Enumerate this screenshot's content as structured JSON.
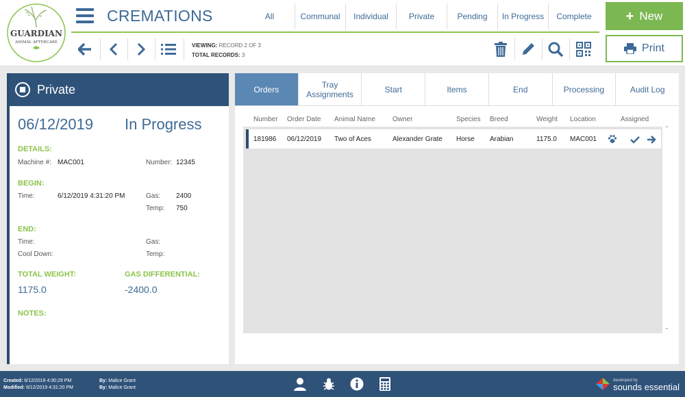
{
  "header": {
    "title": "CREMATIONS",
    "logo_main": "GUARDIAN",
    "logo_sub": "ANIMAL AFTERCARE",
    "filter_tabs": [
      "All",
      "Communal",
      "Individual",
      "Private",
      "Pending",
      "In Progress",
      "Complete"
    ],
    "new_label": "New",
    "print_label": "Print",
    "viewing_label": "VIEWING:",
    "viewing_value": "RECORD 2 OF 3",
    "total_label": "TOTAL RECORDS:",
    "total_value": "3"
  },
  "left": {
    "type": "Private",
    "date": "06/12/2019",
    "status": "In Progress",
    "details_label": "DETAILS:",
    "machine_label": "Machine #:",
    "machine_value": "MAC001",
    "number_label": "Number:",
    "number_value": "12345",
    "begin_label": "BEGIN:",
    "time_label": "Time:",
    "begin_time": "6/12/2019 4:31:20 PM",
    "gas_label": "Gas:",
    "begin_gas": "2400",
    "temp_label": "Temp:",
    "begin_temp": "750",
    "end_label": "END:",
    "cooldown_label": "Cool Down:",
    "total_weight_label": "TOTAL WEIGHT:",
    "total_weight_value": "1175.0",
    "gas_diff_label": "GAS DIFFERENTIAL:",
    "gas_diff_value": "-2400.0",
    "notes_label": "NOTES:"
  },
  "tabs": [
    "Orders",
    "Tray\nAssignments",
    "Start",
    "Items",
    "End",
    "Processing",
    "Audit Log"
  ],
  "table": {
    "columns": [
      "Number",
      "Order Date",
      "Animal Name",
      "Owner",
      "Species",
      "Breed",
      "Weight",
      "Location",
      "Assigned"
    ],
    "rows": [
      [
        "181986",
        "06/12/2019",
        "Two of Aces",
        "Alexander Grate",
        "Horse",
        "Arabian",
        "1175.0",
        "MAC001"
      ]
    ]
  },
  "footer": {
    "created_label": "Created:",
    "created_value": "6/12/2019 4:30:29 PM",
    "modified_label": "Modified:",
    "modified_value": "6/12/2019 4:31:20 PM",
    "by_label": "By:",
    "created_by": "Malice Grant",
    "modified_by": "Malice Grant",
    "brand_small": "developed by",
    "brand_name": "sounds essential"
  },
  "colors": {
    "primary": "#2f5279",
    "accent_green": "#7cb851",
    "active_tab": "#5b87b4"
  }
}
